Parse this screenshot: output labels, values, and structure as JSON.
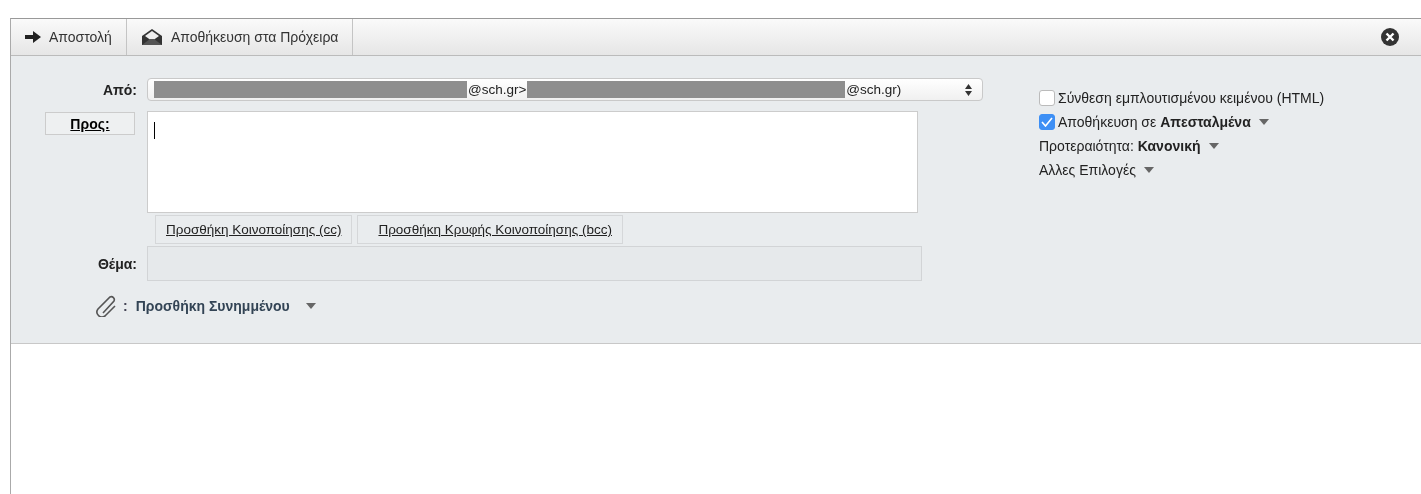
{
  "toolbar": {
    "buttons": [
      {
        "kind": "send",
        "label": "Αποστολή"
      },
      {
        "kind": "draft",
        "label": "Αποθήκευση στα Πρόχειρα"
      }
    ]
  },
  "from": {
    "label": "Από:",
    "segments": [
      {
        "kind": "redacted"
      },
      {
        "kind": "text",
        "text": "@sch.gr>"
      },
      {
        "kind": "redacted"
      },
      {
        "kind": "text",
        "text": "@sch.gr)"
      }
    ]
  },
  "to": {
    "label": "Προς:"
  },
  "recipient_links": [
    "Προσθήκη Κοινοποίησης (cc)",
    "Προσθήκη Κρυφής Κοινοποίησης (bcc)"
  ],
  "subject": {
    "label": "Θέμα:"
  },
  "attachment": {
    "separator": ":",
    "label": "Προσθήκη Συνημμένου"
  },
  "options": [
    {
      "kind": "checkbox",
      "checked": false,
      "text": "Σύνθεση εμπλουτισμένου κειμένου (HTML)"
    },
    {
      "kind": "checkbox",
      "checked": true,
      "text": "Αποθήκευση σε **Απεσταλμένα**",
      "dropdown": true
    },
    {
      "kind": "menu",
      "text": "Προτεραιότητα: **Κανονική**",
      "dropdown": true
    },
    {
      "kind": "menu",
      "text": "Αλλες Επιλογές",
      "dropdown": true
    }
  ]
}
